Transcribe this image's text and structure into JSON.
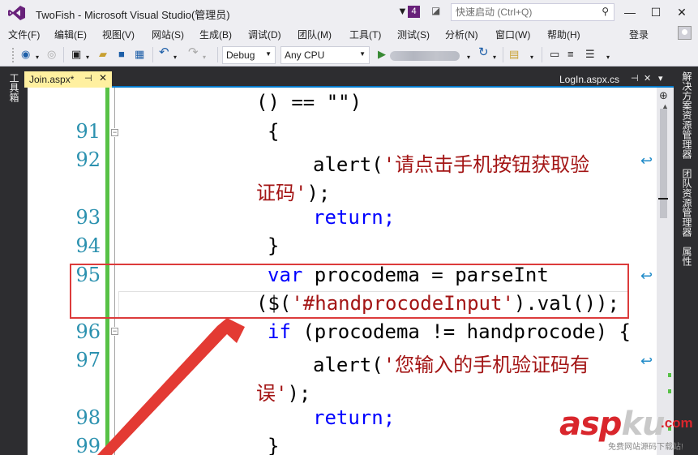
{
  "window": {
    "title": "TwoFish - Microsoft Visual Studio(管理员)",
    "notification_count": "4",
    "quick_launch_placeholder": "快速启动 (Ctrl+Q)"
  },
  "menu": {
    "items": [
      "文件(F)",
      "编辑(E)",
      "视图(V)",
      "网站(S)",
      "生成(B)",
      "调试(D)",
      "团队(M)",
      "工具(T)",
      "测试(S)",
      "分析(N)",
      "窗口(W)",
      "帮助(H)"
    ],
    "sign_in": "登录"
  },
  "toolbar": {
    "configuration": "Debug",
    "platform": "Any CPU"
  },
  "side_panels": {
    "left": [
      "工具箱"
    ],
    "right": [
      "解决方案资源管理器",
      "团队资源管理器",
      "属性"
    ]
  },
  "tabs": {
    "active": "Join.aspx*",
    "inactive": "LogIn.aspx.cs"
  },
  "editor": {
    "line_numbers": [
      "91",
      "92",
      "93",
      "94",
      "95",
      "96",
      "97",
      "98",
      "99"
    ],
    "code": {
      "l0": "() == \"\")",
      "l91": "{",
      "l92_fn": "alert(",
      "l92_str": "'请点击手机按钮获取验",
      "l92b_str": "证码'",
      "l92b_end": ");",
      "l93": "return;",
      "l94": "}",
      "l95_kw": "var",
      "l95_rest": " procodema = parseInt",
      "l95b_pre": "($(",
      "l95b_str": "'#handprocodeInput'",
      "l95b_post": ").val());",
      "l96_kw": "if",
      "l96_rest": " (procodema != handprocode) {",
      "l97_fn": "alert(",
      "l97_str": "'您输入的手机验证码有",
      "l97b_str": "误'",
      "l97b_end": ");",
      "l98": "return;",
      "l99": "}"
    }
  },
  "watermark": {
    "logo_red": "asp",
    "logo_gray": "ku",
    "tld": ".com",
    "slogan": "免费网站源码下载站!"
  },
  "colors": {
    "keyword": "#0000ff",
    "string": "#a31515",
    "line_number": "#2b91af",
    "annotation": "#dc3b3b",
    "active_tab": "#fff0a0",
    "accent": "#007acc"
  }
}
